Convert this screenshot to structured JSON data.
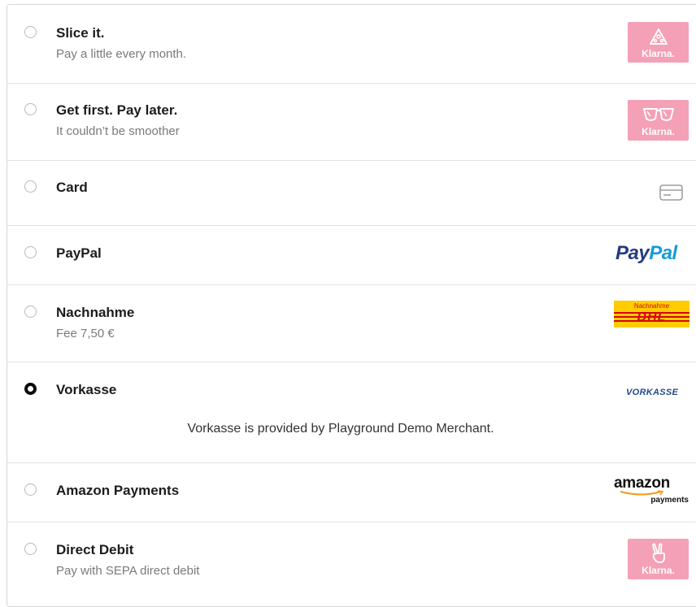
{
  "payment_methods": [
    {
      "title": "Slice it.",
      "subtitle": "Pay a little every month.",
      "logo": "klarna-slice-icon",
      "logo_text": "Klarna.",
      "selected": false
    },
    {
      "title": "Get first. Pay later.",
      "subtitle": "It couldn’t be smoother",
      "logo": "klarna-sunglasses-icon",
      "logo_text": "Klarna.",
      "selected": false
    },
    {
      "title": "Card",
      "subtitle": "",
      "logo": "credit-card-icon",
      "selected": false
    },
    {
      "title": "PayPal",
      "subtitle": "",
      "logo": "paypal-logo",
      "logo_text_1": "Pay",
      "logo_text_2": "Pal",
      "selected": false
    },
    {
      "title": "Nachnahme",
      "subtitle": "Fee 7,50 €",
      "logo": "dhl-logo",
      "logo_top_text": "Nachnahme",
      "logo_text": "DHL",
      "selected": false
    },
    {
      "title": "Vorkasse",
      "subtitle": "",
      "logo": "vorkasse-logo",
      "logo_text": "VORKASSE",
      "selected": true,
      "detail": "Vorkasse is provided by Playground Demo Merchant."
    },
    {
      "title": "Amazon Payments",
      "subtitle": "",
      "logo": "amazon-payments-logo",
      "logo_text_1": "amazon",
      "logo_text_2": "payments",
      "selected": false
    },
    {
      "title": "Direct Debit",
      "subtitle": "Pay with SEPA direct debit",
      "logo": "klarna-peace-icon",
      "logo_text": "Klarna.",
      "selected": false
    }
  ],
  "colors": {
    "klarna_pink": "#f4a0b6",
    "paypal_dark": "#253b80",
    "paypal_light": "#179bd7",
    "dhl_yellow": "#ffcc00",
    "dhl_red": "#d40511",
    "vorkasse_blue": "#1f4a8a"
  }
}
